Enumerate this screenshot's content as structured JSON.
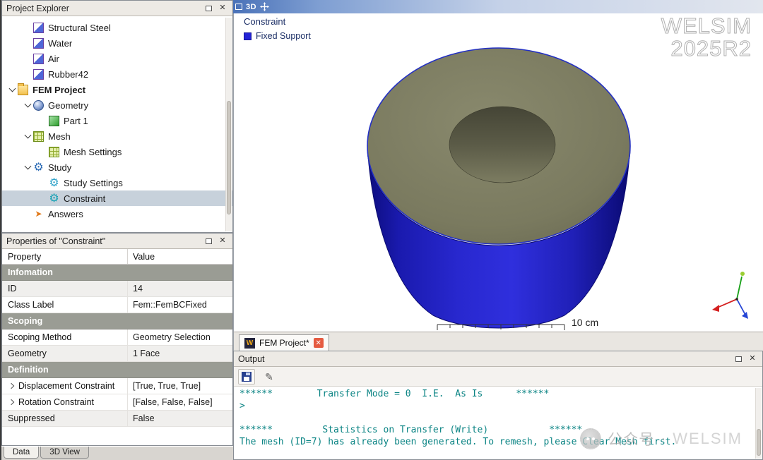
{
  "project_explorer": {
    "title": "Project Explorer",
    "items": [
      {
        "label": "Structural Steel",
        "icon": "material-icon",
        "depth": 1,
        "caret": false
      },
      {
        "label": "Water",
        "icon": "material-icon",
        "depth": 1,
        "caret": false
      },
      {
        "label": "Air",
        "icon": "material-icon",
        "depth": 1,
        "caret": false
      },
      {
        "label": "Rubber42",
        "icon": "material-icon",
        "depth": 1,
        "caret": false
      },
      {
        "label": "FEM Project",
        "icon": "folder-icon",
        "depth": 0,
        "caret": true,
        "bold": true
      },
      {
        "label": "Geometry",
        "icon": "geometry-icon",
        "depth": 1,
        "caret": true
      },
      {
        "label": "Part 1",
        "icon": "part-icon",
        "depth": 2,
        "caret": false
      },
      {
        "label": "Mesh",
        "icon": "mesh-icon",
        "depth": 1,
        "caret": true
      },
      {
        "label": "Mesh Settings",
        "icon": "mesh-settings-icon",
        "depth": 2,
        "caret": false
      },
      {
        "label": "Study",
        "icon": "study-icon",
        "depth": 1,
        "caret": true
      },
      {
        "label": "Study Settings",
        "icon": "study-settings-icon",
        "depth": 2,
        "caret": false
      },
      {
        "label": "Constraint",
        "icon": "constraint-icon",
        "depth": 2,
        "caret": false,
        "selected": true
      },
      {
        "label": "Answers",
        "icon": "answers-icon",
        "depth": 1,
        "caret": false
      }
    ]
  },
  "properties_panel": {
    "title": "Properties of \"Constraint\"",
    "columns": [
      "Property",
      "Value"
    ],
    "rows": [
      {
        "type": "section",
        "label": "Infomation"
      },
      {
        "type": "row",
        "label": "ID",
        "value": "14"
      },
      {
        "type": "row",
        "label": "Class Label",
        "value": "Fem::FemBCFixed"
      },
      {
        "type": "section",
        "label": "Scoping"
      },
      {
        "type": "row",
        "label": "Scoping Method",
        "value": "Geometry Selection"
      },
      {
        "type": "row",
        "label": "Geometry",
        "value": "1 Face"
      },
      {
        "type": "section",
        "label": "Definition"
      },
      {
        "type": "row",
        "label": "Displacement Constraint",
        "value": "[True, True, True]",
        "expander": true
      },
      {
        "type": "row",
        "label": "Rotation Constraint",
        "value": "[False, False, False]",
        "expander": true
      },
      {
        "type": "row",
        "label": "Suppressed",
        "value": "False"
      }
    ]
  },
  "bottom_tabs": [
    {
      "label": "Data",
      "active": true
    },
    {
      "label": "3D View",
      "active": false
    }
  ],
  "viewport": {
    "titlebar_label": "3D",
    "legend_title": "Constraint",
    "legend_item_label": "Fixed Support",
    "legend_swatch_color": "#2323d6",
    "brand_watermark_line1": "WELSIM",
    "brand_watermark_line2": "2025R2",
    "scale_label": "10 cm",
    "doc_tab_label": "FEM Project*"
  },
  "output": {
    "title": "Output",
    "lines": [
      "******        Transfer Mode = 0  I.E.  As Is      ******",
      ">",
      "",
      "******         Statistics on Transfer (Write)           ******",
      "The mesh (ID=7) has already been generated. To remesh, please Clear Mesh first."
    ]
  },
  "page_watermark": {
    "text_cn": "公众号",
    "separator": "·",
    "text_en": "WELSIM"
  },
  "colors": {
    "console_text": "#0b8484",
    "fixed_support_blue": "#2323d6",
    "section_header_bg": "#9a9c94",
    "body_top_face": "#7a7a5f",
    "body_side": "#2828cf"
  }
}
